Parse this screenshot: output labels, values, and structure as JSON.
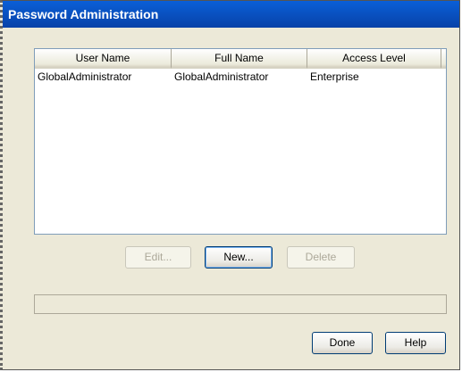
{
  "window": {
    "title": "Password Administration"
  },
  "users_table": {
    "columns": [
      "User Name",
      "Full Name",
      "Access Level"
    ],
    "rows": [
      {
        "user_name": "GlobalAdministrator",
        "full_name": "GlobalAdministrator",
        "access_level": "Enterprise"
      }
    ]
  },
  "actions": {
    "edit_label": "Edit...",
    "new_label": "New...",
    "delete_label": "Delete"
  },
  "footer": {
    "done_label": "Done",
    "help_label": "Help"
  },
  "colors": {
    "titlebar": "#0a5fd8",
    "dialog_bg": "#ece9d8",
    "list_border": "#7f9db9"
  }
}
